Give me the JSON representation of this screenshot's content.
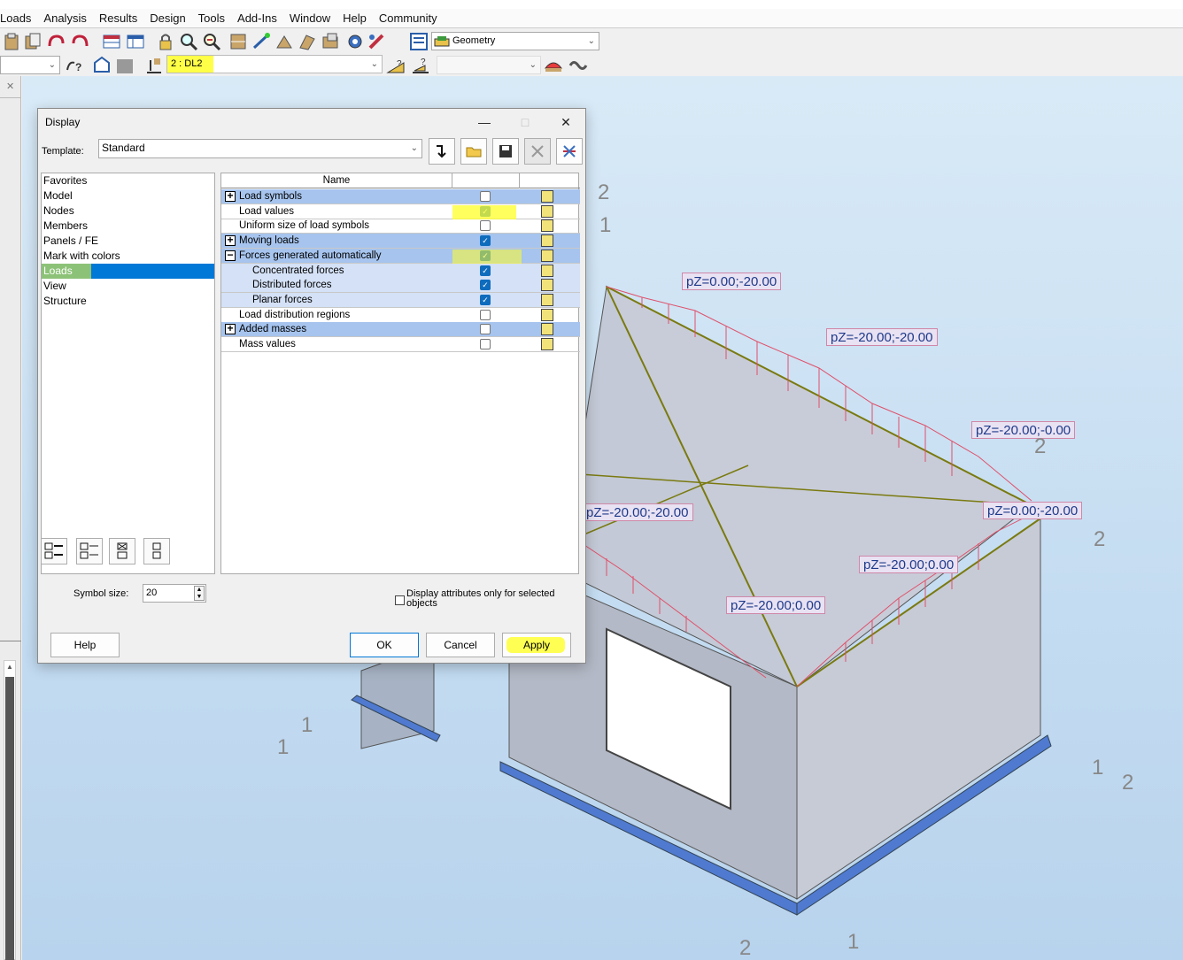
{
  "menu": [
    "Loads",
    "Analysis",
    "Results",
    "Design",
    "Tools",
    "Add-Ins",
    "Window",
    "Help",
    "Community"
  ],
  "toolbar": {
    "view_combo": "Geometry",
    "load_case_combo": "2 : DL2",
    "help_icon_label": "?"
  },
  "dialog": {
    "title": "Display",
    "template_label": "Template:",
    "template_value": "Standard",
    "categories": [
      "Favorites",
      "Model",
      "Nodes",
      "Members",
      "Panels / FE",
      "Mark with colors",
      "Loads",
      "View",
      "Structure"
    ],
    "selected_category": "Loads",
    "grid_header": "Name",
    "rows": [
      {
        "name": "Load symbols",
        "checked": false,
        "expander": "+",
        "style": "blue"
      },
      {
        "name": "Load values",
        "checked": true,
        "expander": "",
        "style": "white"
      },
      {
        "name": "Uniform size of load symbols",
        "checked": false,
        "expander": "",
        "style": "white"
      },
      {
        "name": "Moving loads",
        "checked": true,
        "expander": "+",
        "style": "blue"
      },
      {
        "name": "Forces generated automatically",
        "checked": true,
        "expander": "−",
        "style": "blue"
      },
      {
        "name": "Concentrated forces",
        "checked": true,
        "expander": "",
        "style": "sub"
      },
      {
        "name": "Distributed forces",
        "checked": true,
        "expander": "",
        "style": "sub"
      },
      {
        "name": "Planar forces",
        "checked": true,
        "expander": "",
        "style": "sub"
      },
      {
        "name": "Load distribution regions",
        "checked": false,
        "expander": "",
        "style": "white"
      },
      {
        "name": "Added masses",
        "checked": false,
        "expander": "+",
        "style": "blue"
      },
      {
        "name": "Mass values",
        "checked": false,
        "expander": "",
        "style": "white"
      }
    ],
    "symbol_size_label": "Symbol size:",
    "symbol_size_value": "20",
    "selected_only_label": "Display attributes only for selected objects",
    "buttons": {
      "help": "Help",
      "ok": "OK",
      "cancel": "Cancel",
      "apply": "Apply"
    }
  },
  "viewport": {
    "load_labels": [
      "pZ=0.00;-20.00",
      "pZ=-20.00;-20.00",
      "pZ=-20.00;-0.00",
      "pZ=-20.00;-20.00",
      "pZ=0.00;-20.00",
      "pZ=-20.00;0.00",
      "pZ=-20.00;0.00"
    ],
    "axis_labels": [
      "2",
      "1",
      "2",
      "2",
      "1",
      "1",
      "1",
      "2",
      "2",
      "1"
    ]
  },
  "colors": {
    "selection": "#0078d7",
    "highlight": "#ffff28",
    "load_line": "#e0506a",
    "roof_edge": "#7a7a10"
  }
}
